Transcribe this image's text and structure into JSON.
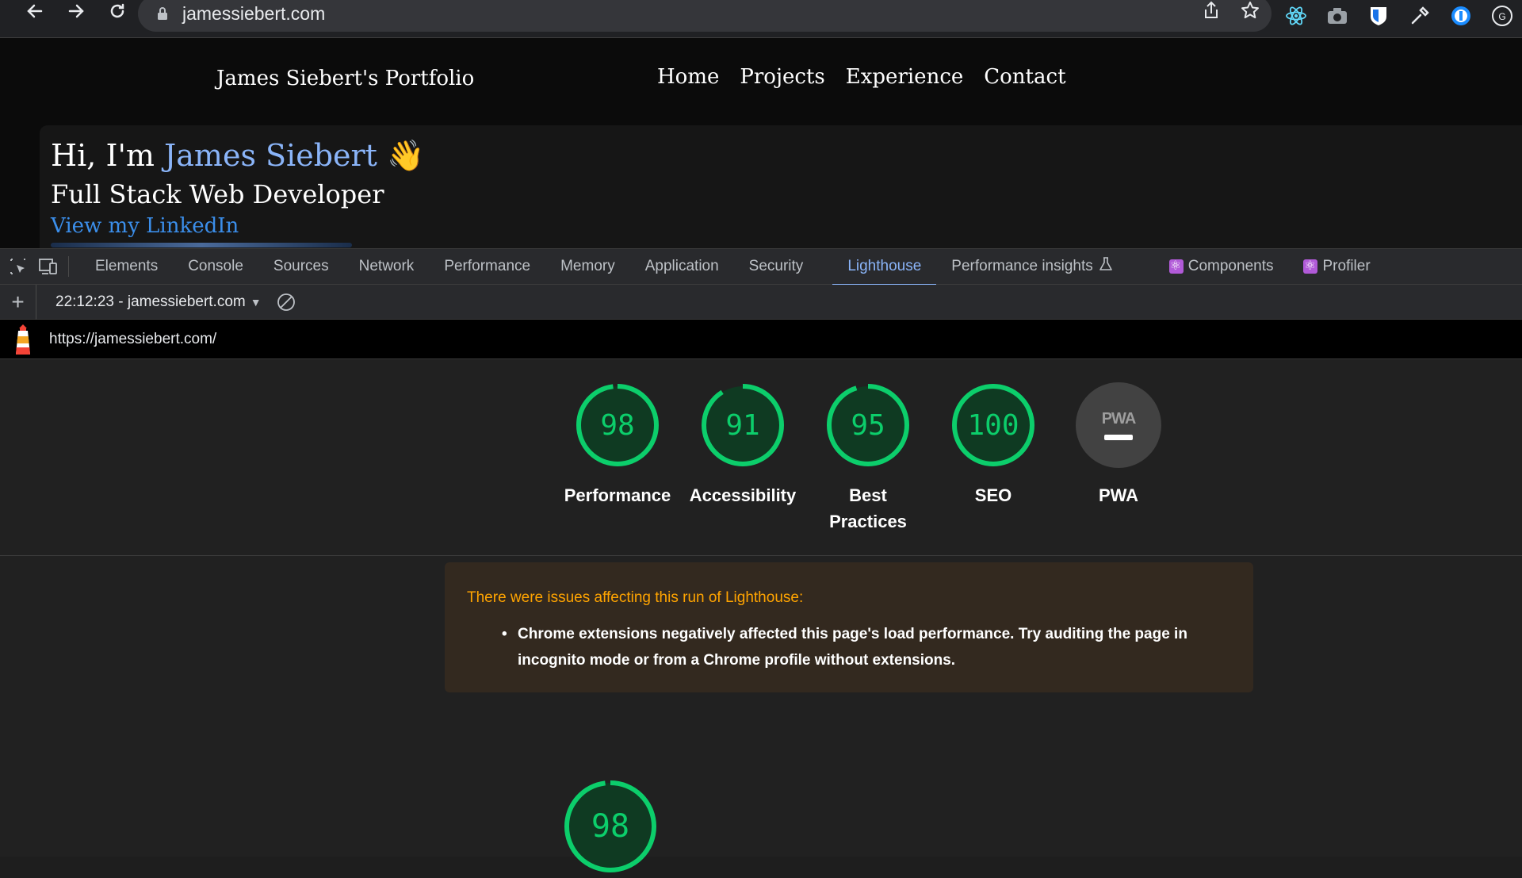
{
  "browser": {
    "url": "jamessiebert.com"
  },
  "site": {
    "brand": "James Siebert's Portfolio",
    "nav": [
      "Home",
      "Projects",
      "Experience",
      "Contact"
    ],
    "greeting_prefix": "Hi, I'm ",
    "greeting_name": "James Siebert",
    "greeting_emoji": "👋",
    "subtitle": "Full Stack Web Developer",
    "link": "View my LinkedIn"
  },
  "devtools": {
    "tabs": [
      "Elements",
      "Console",
      "Sources",
      "Network",
      "Performance",
      "Memory",
      "Application",
      "Security",
      "Lighthouse",
      "Performance insights",
      "Components",
      "Profiler"
    ],
    "active_tab": "Lighthouse"
  },
  "lighthouse": {
    "run_label": "22:12:23 - jamessiebert.com",
    "report_url": "https://jamessiebert.com/",
    "scores": [
      {
        "label": "Performance",
        "score": "98",
        "value": 98
      },
      {
        "label": "Accessibility",
        "score": "91",
        "value": 91
      },
      {
        "label": "Best Practices",
        "score": "95",
        "value": 95
      },
      {
        "label": "SEO",
        "score": "100",
        "value": 100
      }
    ],
    "pwa_label": "PWA",
    "pwa_badge": "PWA",
    "warning_title": "There were issues affecting this run of Lighthouse:",
    "warning_items": [
      "Chrome extensions negatively affected this page's load performance. Try auditing the page in incognito mode or from a Chrome profile without extensions."
    ],
    "bottom_score": "98",
    "bottom_value": 98
  },
  "colors": {
    "pass": "#0cce6b",
    "warning_text": "#ffa400",
    "active_tab": "#8ab4f8"
  }
}
